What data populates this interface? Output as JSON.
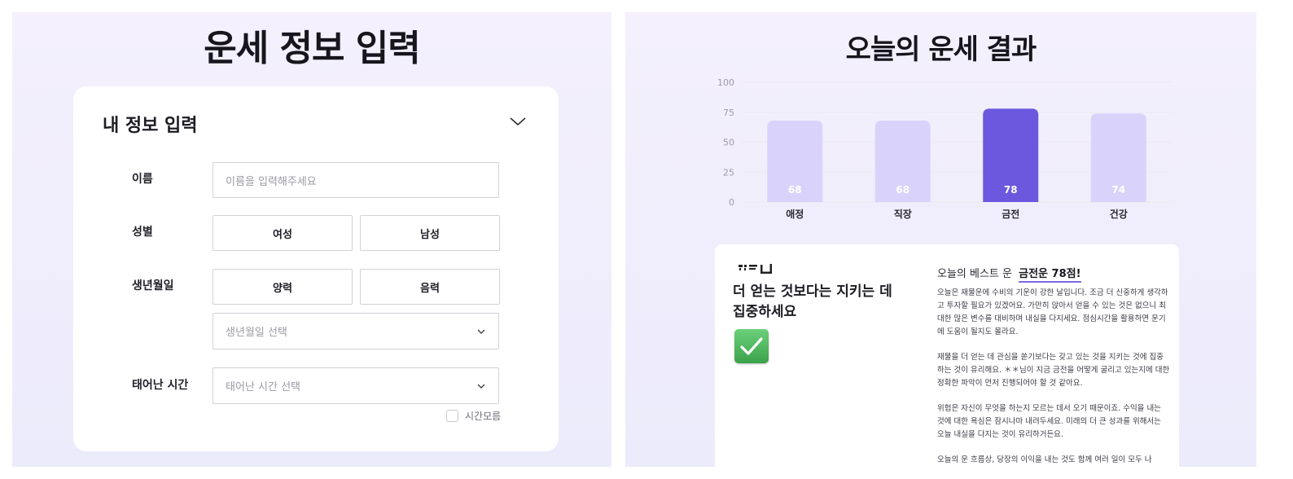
{
  "left": {
    "title": "운세 정보 입력",
    "card": {
      "header": "내 정보 입력",
      "name": {
        "label": "이름",
        "placeholder": "이름을 입력해주세요"
      },
      "gender": {
        "label": "성별",
        "options": [
          "여성",
          "남성"
        ]
      },
      "birth": {
        "label": "생년월일",
        "options": [
          "양력",
          "음력"
        ],
        "select_placeholder": "생년월일 선택"
      },
      "time": {
        "label": "태어난 시간",
        "select_placeholder": "태어난 시간 선택",
        "unknown_label": "시간모름"
      }
    }
  },
  "right": {
    "title": "오늘의 운세 결과",
    "result": {
      "headline": "더 얻는 것보다는 지키는 데 집중하세요",
      "best_prefix": "오늘의 베스트 운",
      "best_value": "금전운 78점!",
      "paragraphs": [
        "오늘은 재물운에 수비의 기운이 강한 날입니다. 조금 더 신중하게 생각하고 투자할 필요가 있겠어요. 가만히 앉아서 얻을 수 있는 것은 없으니 최대한 많은 변수를 대비하며 내실을 다지세요. 점심시간을 활용하면 운기에 도움이 될지도 몰라요.",
        "재물을 더 얻는 데 관심을 쏟기보다는 갖고 있는 것을 지키는 것에 집중하는 것이 유리해요. ＊＊님이 지금 금전을 어떻게 굴리고 있는지에 대한 정확한 파악이 먼저 진행되어야 할 것 같아요.",
        "위험은 자신이 무엇을 하는지 모르는 데서 오기 때문이죠. 수익을 내는 것에 대한 욕심은 잠시나마 내려두세요. 미래의 더 큰 성과를 위해서는 오늘 내실을 다지는 것이 유리하거든요.",
        "오늘의 운 흐름상, 당장의 이익을 내는 것도 함께 여러 일이 모두 나"
      ]
    }
  },
  "chart_data": {
    "type": "bar",
    "categories": [
      "애정",
      "직장",
      "금전",
      "건강"
    ],
    "values": [
      68,
      68,
      78,
      74
    ],
    "ylim": [
      0,
      100
    ],
    "yticks": [
      0,
      25,
      50,
      75,
      100
    ],
    "grid": true,
    "highlight_index": 2,
    "colors": {
      "bar": "#d9d3fb",
      "highlight": "#6b58df",
      "label_on_bar": "#ffffff",
      "axis_text": "#9b9ba5",
      "grid": "#ebebf0"
    }
  },
  "icons": {
    "collapse": "chevron-down-icon",
    "select": "chevron-down-icon",
    "check": "check-mark-icon"
  }
}
